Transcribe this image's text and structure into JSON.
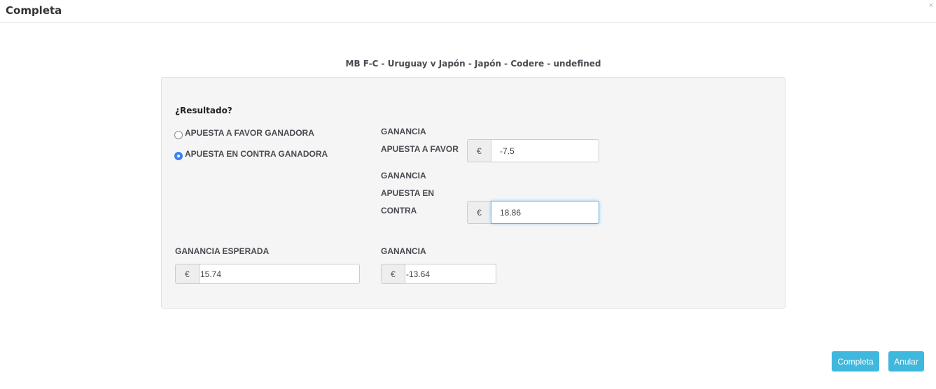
{
  "modal": {
    "title": "Completa",
    "close_symbol": "×"
  },
  "bet_title": "MB F-C - Uruguay v Japón - Japón - Codere - undefined",
  "result": {
    "question": "¿Resultado?",
    "options": [
      {
        "label": "APUESTA A FAVOR GANADORA",
        "checked": false
      },
      {
        "label": "APUESTA EN CONTRA GANADORA",
        "checked": true
      }
    ]
  },
  "currency_symbol": "€",
  "ganancia_favor": {
    "label_line1": "GANANCIA",
    "label_line2": "APUESTA A FAVOR",
    "value": "-7.5"
  },
  "ganancia_contra": {
    "label_line1": "GANANCIA",
    "label_line2": "APUESTA EN",
    "label_line3": "CONTRA",
    "value": "18.86"
  },
  "ganancia_esperada": {
    "label": "GANANCIA ESPERADA",
    "value": "15.74"
  },
  "ganancia": {
    "label": "GANANCIA",
    "value": "-13.64"
  },
  "footer": {
    "complete_label": "Completa",
    "cancel_label": "Anular"
  },
  "colors": {
    "primary_button": "#3fb8de",
    "radio_checked": "#3b82f6",
    "focus_border": "#66afe9"
  }
}
